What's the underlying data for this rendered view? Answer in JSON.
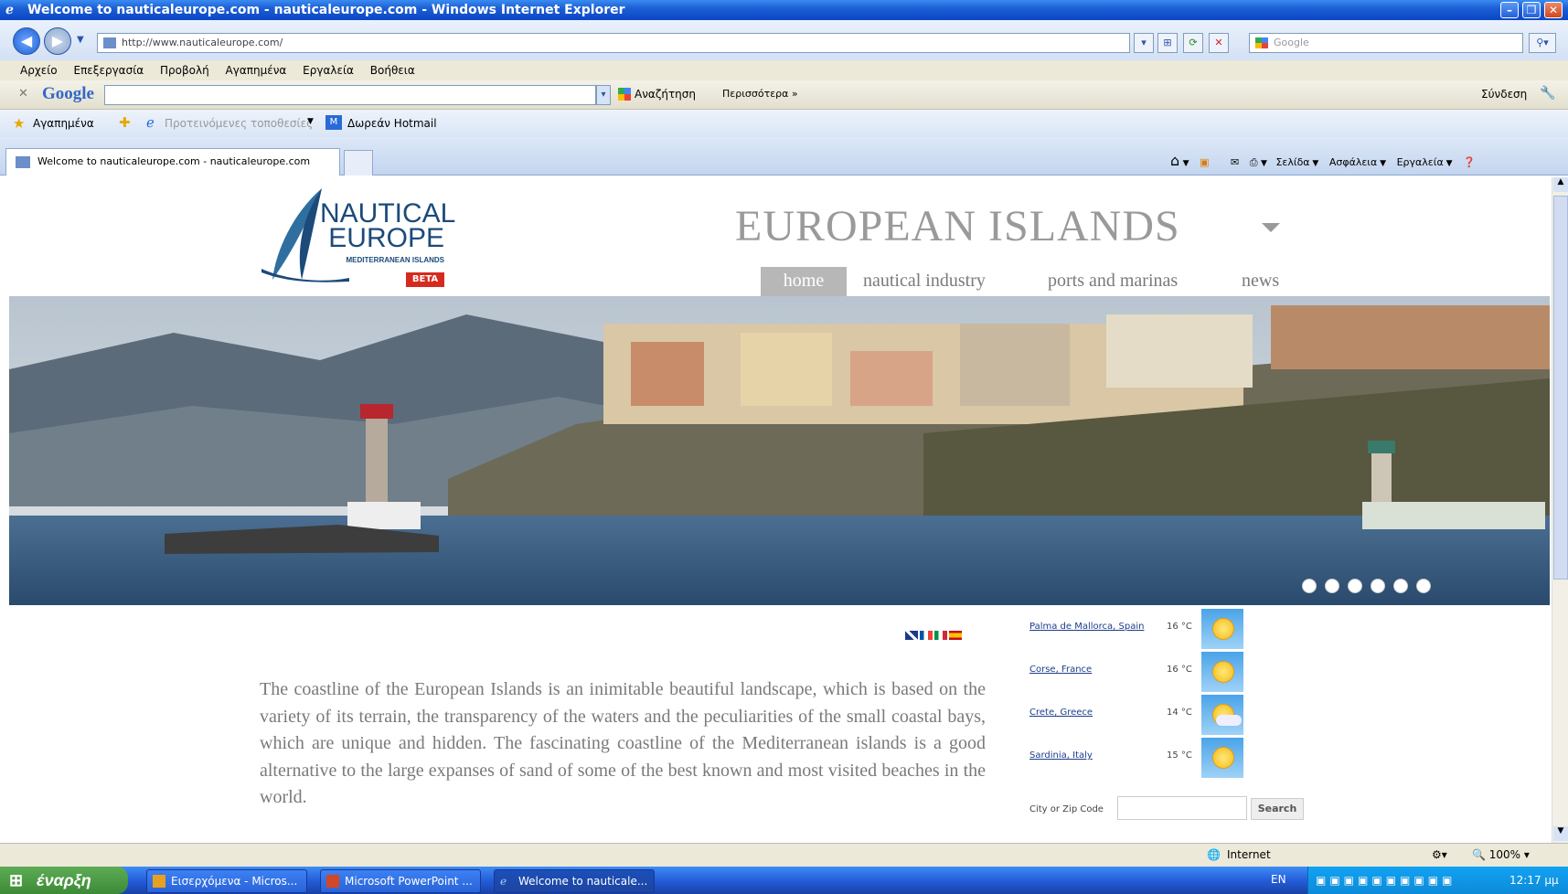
{
  "window": {
    "title": "Welcome to nauticaleurope.com - nauticaleurope.com - Windows Internet Explorer"
  },
  "address_bar": {
    "url": "http://www.nauticaleurope.com/",
    "search_placeholder": "Google"
  },
  "menu": [
    "Αρχείο",
    "Επεξεργασία",
    "Προβολή",
    "Αγαπημένα",
    "Εργαλεία",
    "Βοήθεια"
  ],
  "google_toolbar": {
    "logo": "Google",
    "search_label": "Αναζήτηση",
    "more_label": "Περισσότερα »",
    "signin_label": "Σύνδεση"
  },
  "favorites_bar": {
    "favorites_label": "Αγαπημένα",
    "suggested_sites": "Προτεινόμενες τοποθεσίες",
    "hotmail": "Δωρεάν Hotmail"
  },
  "tab": {
    "label": "Welcome to nauticaleurope.com - nauticaleurope.com"
  },
  "command_bar": {
    "page": "Σελίδα",
    "safety": "Ασφάλεια",
    "tools": "Εργαλεία"
  },
  "site": {
    "logo_line1": "NAUTICAL",
    "logo_line2": "EUROPE",
    "logo_sub": "MEDITERRANEAN ISLANDS",
    "beta": "BETA",
    "title": "EUROPEAN ISLANDS",
    "nav": [
      "home",
      "nautical industry",
      "ports and marinas",
      "news"
    ],
    "body": "The coastline of the European Islands is an inimitable beautiful landscape, which is based on the variety of its terrain, the transparency of the waters and the peculiarities of the small coastal bays, which are unique and hidden. The fascinating coastline of the Mediterranean islands is a good alternative to the large expanses of sand of some of the best known and most visited beaches in the world.",
    "weather": [
      {
        "city": "Palma de Mallorca, Spain",
        "temp": "16 °C",
        "icon": "sun-icon"
      },
      {
        "city": "Corse, France",
        "temp": "16 °C",
        "icon": "sun-icon"
      },
      {
        "city": "Crete, Greece",
        "temp": "14 °C",
        "icon": "sun-cloud-icon"
      },
      {
        "city": "Sardinia, Italy",
        "temp": "15 °C",
        "icon": "sun-icon"
      }
    ],
    "zip_label": "City or Zip Code",
    "search_button": "Search"
  },
  "status_bar": {
    "zone": "Internet",
    "zoom": "100%"
  },
  "taskbar": {
    "start": "έναρξη",
    "tasks": [
      "Εισερχόμενα - Micros...",
      "Microsoft PowerPoint ...",
      "Welcome to nauticale..."
    ],
    "lang": "EN",
    "clock": "12:17 μμ"
  }
}
